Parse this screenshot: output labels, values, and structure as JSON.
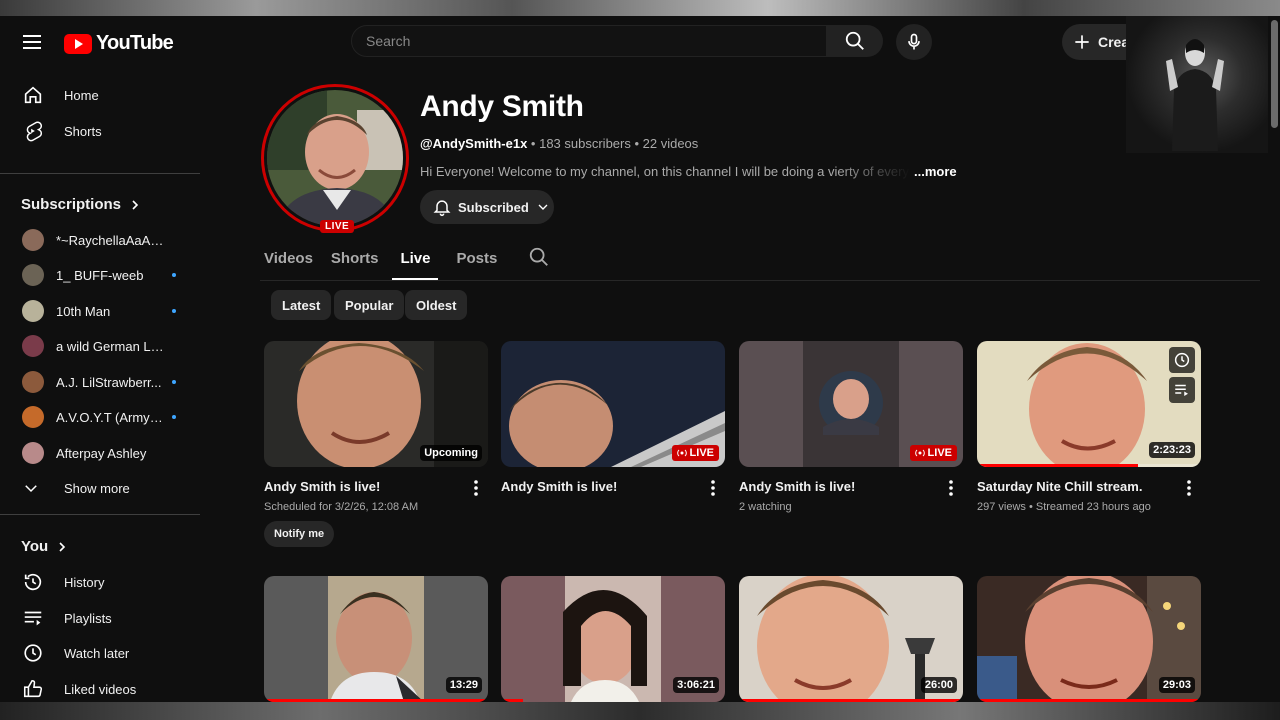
{
  "header": {
    "logo_text": "YouTube",
    "search_placeholder": "Search",
    "create_label": "Creat"
  },
  "sidebar": {
    "main": [
      {
        "label": "Home",
        "icon": "home-icon"
      },
      {
        "label": "Shorts",
        "icon": "shorts-icon"
      }
    ],
    "subscriptions_title": "Subscriptions",
    "subscriptions": [
      {
        "label": "*~RaychellaAaAaA...",
        "dot": false,
        "color": "#8a6a5a"
      },
      {
        "label": "1_ BUFF-weeb",
        "dot": true,
        "color": "#6b6355"
      },
      {
        "label": "10th Man",
        "dot": true,
        "color": "#b8b29a"
      },
      {
        "label": "a wild German Lady ...",
        "dot": false,
        "color": "#7a3b4a"
      },
      {
        "label": "A.J. LilStrawberr...",
        "dot": true,
        "color": "#8c5a3c"
      },
      {
        "label": "A.V.O.Y.T (ArmyV...",
        "dot": true,
        "color": "#c56a2a"
      },
      {
        "label": "Afterpay Ashley",
        "dot": false,
        "color": "#b88a8a"
      }
    ],
    "show_more": "Show more",
    "you_title": "You",
    "you": [
      {
        "label": "History",
        "icon": "history-icon"
      },
      {
        "label": "Playlists",
        "icon": "playlists-icon"
      },
      {
        "label": "Watch later",
        "icon": "watch-later-icon"
      },
      {
        "label": "Liked videos",
        "icon": "like-icon"
      }
    ]
  },
  "channel": {
    "name": "Andy Smith",
    "handle": "@AndySmith-e1x",
    "stats": " • 183 subscribers • 22 videos",
    "description": "Hi Everyone! Welcome to my channel, on this channel I will be doing a vierty of everything",
    "more": "...more",
    "live_badge": "LIVE",
    "subscribed_label": "Subscribed"
  },
  "tabs": [
    {
      "label": "Videos",
      "active": false
    },
    {
      "label": "Shorts",
      "active": false
    },
    {
      "label": "Live",
      "active": true
    },
    {
      "label": "Posts",
      "active": false
    }
  ],
  "chips": [
    "Latest",
    "Popular",
    "Oldest"
  ],
  "videos_row1": [
    {
      "title": "Andy Smith is live!",
      "meta": "Scheduled for 3/2/26, 12:08 AM",
      "badge": "Upcoming",
      "badge_type": "upcoming",
      "action": "Notify me"
    },
    {
      "title": "Andy Smith is live!",
      "meta": "",
      "badge": "LIVE",
      "badge_type": "live"
    },
    {
      "title": "Andy Smith is live!",
      "meta": "2 watching",
      "badge": "LIVE",
      "badge_type": "live"
    },
    {
      "title": "Saturday Nite Chill stream.",
      "meta": "297 views • Streamed 23 hours ago",
      "badge": "2:23:23",
      "badge_type": "duration",
      "progress": 0.72
    }
  ],
  "videos_row2": [
    {
      "duration": "13:29",
      "progress": 1.0
    },
    {
      "duration": "3:06:21",
      "progress": 0.1
    },
    {
      "duration": "26:00",
      "progress": 1.0
    },
    {
      "duration": "29:03",
      "progress": 1.0
    }
  ],
  "colors": {
    "accent_red": "#cc0000",
    "background": "#0f0f0f",
    "surface": "#272727",
    "dot_blue": "#3ea6ff"
  }
}
